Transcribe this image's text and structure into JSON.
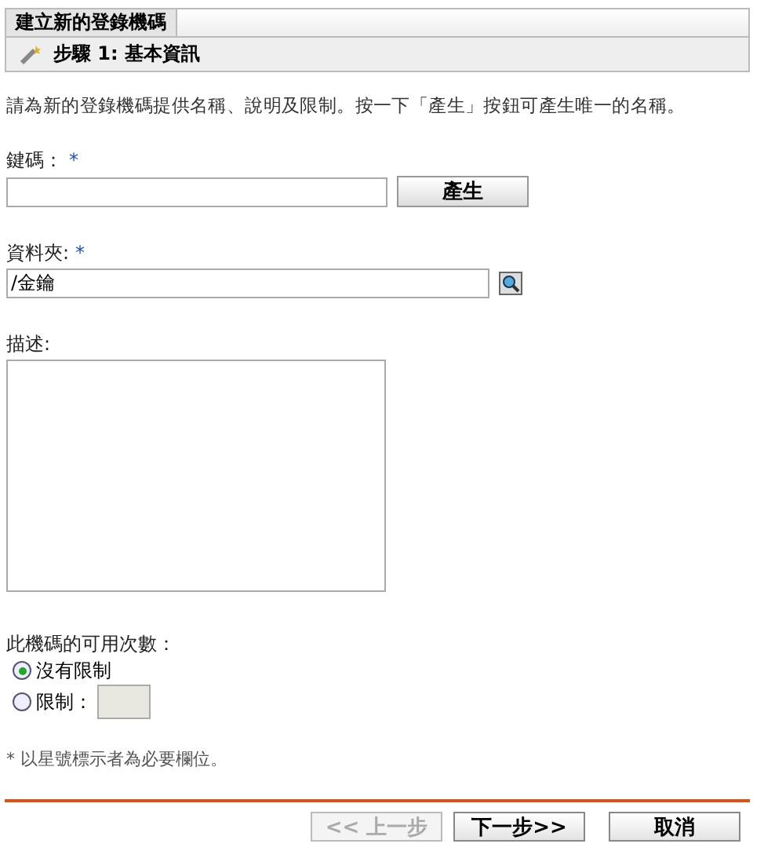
{
  "tab": {
    "label": "建立新的登錄機碼"
  },
  "step": {
    "title": "步驟 1: 基本資訊"
  },
  "intro": "請為新的登錄機碼提供名稱、說明及限制。按一下「產生」按鈕可產生唯一的名稱。",
  "fields": [
    {
      "kind": "text",
      "label": "鍵碼：",
      "mark": "*",
      "button": "產生"
    },
    {
      "kind": "browse",
      "label": "資料夾:",
      "mark": "*",
      "value": "/金鑰"
    },
    {
      "kind": "textarea",
      "label": "描述:"
    }
  ],
  "usage": {
    "label": "此機碼的可用次數：",
    "options": [
      {
        "kind": "plain",
        "label": "沒有限制",
        "selected": true
      },
      {
        "kind": "count",
        "label": "限制：",
        "disabled": true,
        "selected": false
      }
    ]
  },
  "footnote": "* 以星號標示者為必要欄位。",
  "buttons": [
    {
      "label": "<< 上一步",
      "disabled": true
    },
    {
      "label": "下一步>>",
      "disabled": false
    },
    {
      "label": "取消",
      "disabled": false
    }
  ]
}
